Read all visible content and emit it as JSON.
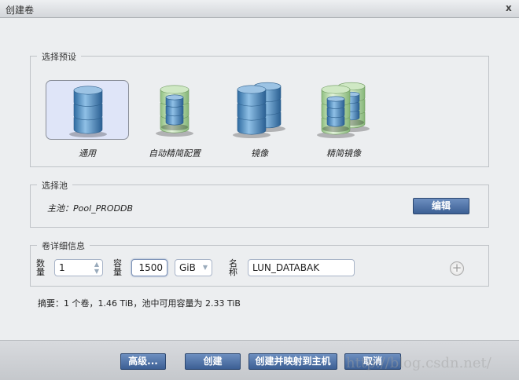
{
  "dialog": {
    "title": "创建卷",
    "close_label": "x"
  },
  "preset": {
    "legend": "选择预设",
    "items": [
      {
        "label": "通用",
        "icon": "database-blue-icon",
        "selected": true
      },
      {
        "label": "自动精简配置",
        "icon": "database-thin-icon",
        "selected": false
      },
      {
        "label": "镜像",
        "icon": "database-mirror-icon",
        "selected": false
      },
      {
        "label": "精简镜像",
        "icon": "database-thin-mirror-icon",
        "selected": false
      }
    ]
  },
  "pool": {
    "legend": "选择池",
    "main_pool": "主池：Pool_PRODDB",
    "edit_label": "编辑"
  },
  "details": {
    "legend": "卷详细信息",
    "count_label": "数量",
    "count_value": "1",
    "capacity_label": "容量",
    "capacity_value": "1500",
    "unit_value": "GiB",
    "name_label": "名称",
    "name_value": "LUN_DATABAK"
  },
  "summary": "摘要：1 个卷，1.46 TiB，池中可用容量为 2.33 TiB",
  "footer": {
    "advanced_label": "高级...",
    "create_label": "创建",
    "create_map_label": "创建并映射到主机",
    "cancel_label": "取消"
  },
  "watermark": "http://blog.csdn.net/"
}
